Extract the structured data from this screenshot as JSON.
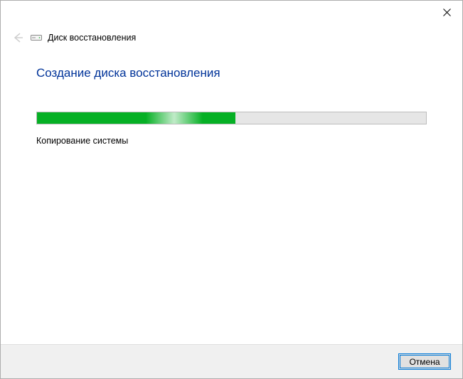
{
  "window": {
    "title": "Диск восстановления"
  },
  "page": {
    "title": "Создание диска восстановления",
    "status": "Копирование системы"
  },
  "progress": {
    "percent": 51
  },
  "buttons": {
    "cancel": "Отмена"
  }
}
